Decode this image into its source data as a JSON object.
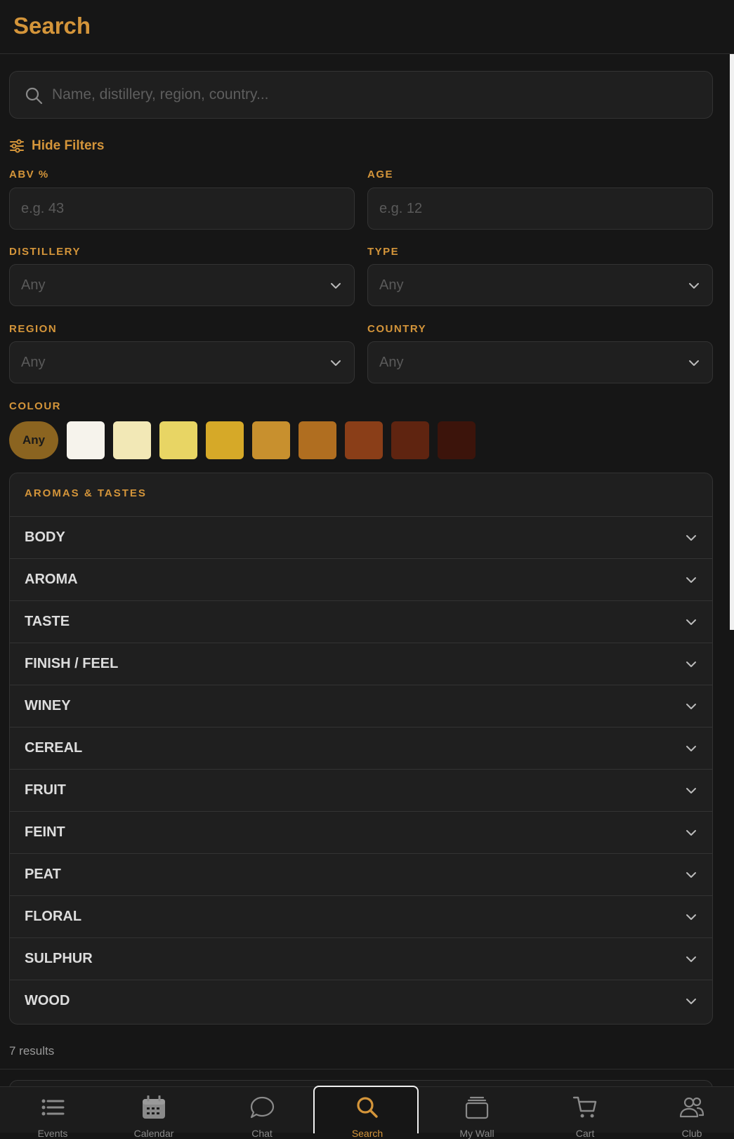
{
  "header": {
    "title": "Search"
  },
  "search": {
    "placeholder": "Name, distillery, region, country..."
  },
  "filters": {
    "toggle_label": "Hide Filters",
    "abv": {
      "label": "ABV %",
      "placeholder": "e.g. 43"
    },
    "age": {
      "label": "AGE",
      "placeholder": "e.g. 12"
    },
    "distillery": {
      "label": "DISTILLERY",
      "value": "Any"
    },
    "type": {
      "label": "TYPE",
      "value": "Any"
    },
    "region": {
      "label": "REGION",
      "value": "Any"
    },
    "country": {
      "label": "COUNTRY",
      "value": "Any"
    },
    "colour": {
      "label": "COLOUR",
      "any_label": "Any",
      "swatches": [
        "#f6f3ec",
        "#f2e8b6",
        "#e8d564",
        "#d6a928",
        "#c8902e",
        "#b06e20",
        "#8a3e18",
        "#5f2410",
        "#3c140b"
      ]
    }
  },
  "aromas": {
    "title": "AROMAS & TASTES",
    "items": [
      "BODY",
      "AROMA",
      "TASTE",
      "FINISH / FEEL",
      "WINEY",
      "CEREAL",
      "FRUIT",
      "FEINT",
      "PEAT",
      "FLORAL",
      "SULPHUR",
      "WOOD"
    ]
  },
  "results": {
    "text": "7 results"
  },
  "nav": {
    "items": [
      {
        "label": "Events",
        "icon": "list-icon"
      },
      {
        "label": "Calendar",
        "icon": "calendar-icon"
      },
      {
        "label": "Chat",
        "icon": "chat-icon"
      },
      {
        "label": "Search",
        "icon": "search-icon"
      },
      {
        "label": "My Wall",
        "icon": "layers-icon"
      },
      {
        "label": "Cart",
        "icon": "cart-icon"
      },
      {
        "label": "Club",
        "icon": "users-icon"
      }
    ],
    "active": "Search"
  },
  "colors": {
    "accent": "#d4953a",
    "background": "#161616",
    "surface": "#1f1f1f"
  }
}
